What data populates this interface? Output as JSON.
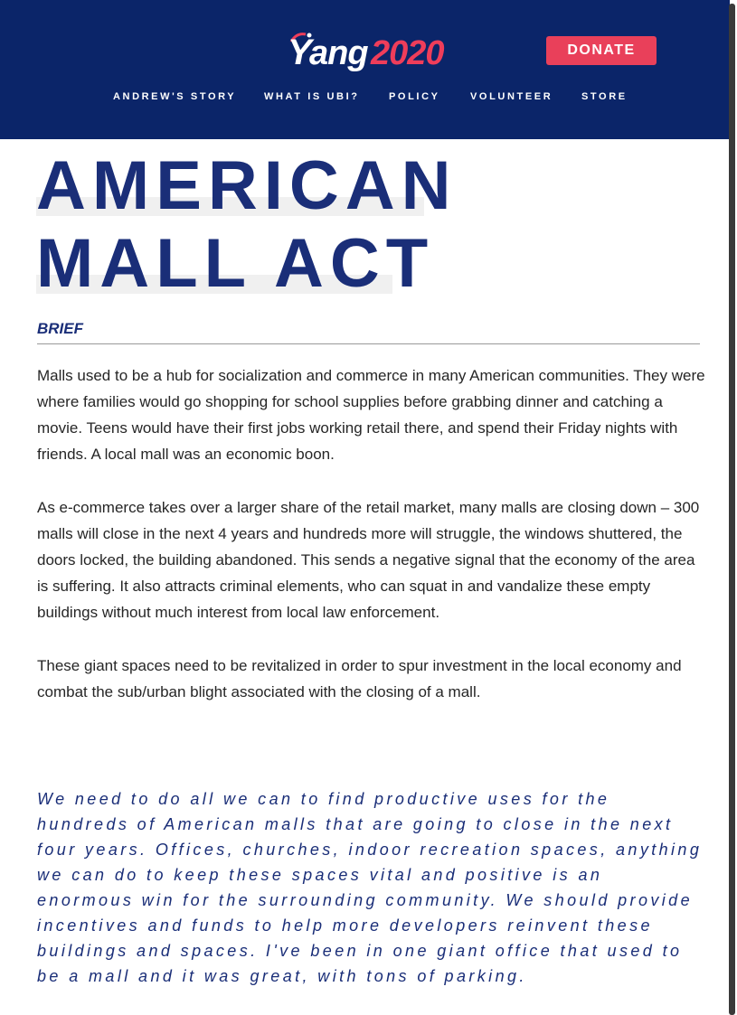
{
  "logo": {
    "y": "Y",
    "name": "ang",
    "year": "2020"
  },
  "header": {
    "donate_label": "DONATE"
  },
  "nav": [
    {
      "label": "ANDREW'S STORY"
    },
    {
      "label": "WHAT IS UBI?"
    },
    {
      "label": "POLICY"
    },
    {
      "label": "VOLUNTEER"
    },
    {
      "label": "STORE"
    }
  ],
  "page": {
    "title_line1": "AMERICAN",
    "title_line2": "MALL ACT",
    "section_label": "BRIEF"
  },
  "paragraphs": [
    "Malls used to be a hub for socialization and commerce in many American communities. They were where families would go shopping for school supplies before grabbing dinner and catching a movie. Teens would have their first jobs working retail there, and spend their Friday nights with friends. A local mall was an economic boon.",
    "As e-commerce takes over a larger share of the retail market, many malls are closing down – 300 malls will close in the next 4 years and hundreds more will struggle, the windows shuttered, the doors locked, the building abandoned. This sends a negative signal that the economy of the area is suffering. It also attracts criminal elements, who can squat in and vandalize these empty buildings without much interest from local law enforcement.",
    "These giant spaces need to be revitalized in order to spur investment in the local economy and combat the sub/urban blight associated with the closing of a mall."
  ],
  "quote": "We need to do all we can to find productive uses for the hundreds of American malls that are going to close in the next four years. Offices, churches, indoor recreation spaces, anything we can do to keep these spaces vital and positive is an enormous win for the surrounding community. We should provide incentives and funds to help more developers reinvent these buildings and spaces. I've been in one giant office that used to be a mall and it was great, with tons of parking.",
  "colors": {
    "header_bg": "#0b2569",
    "donate_bg": "#e9405a",
    "brand_navy": "#1a2e78",
    "logo_red": "#ef3d5a"
  }
}
